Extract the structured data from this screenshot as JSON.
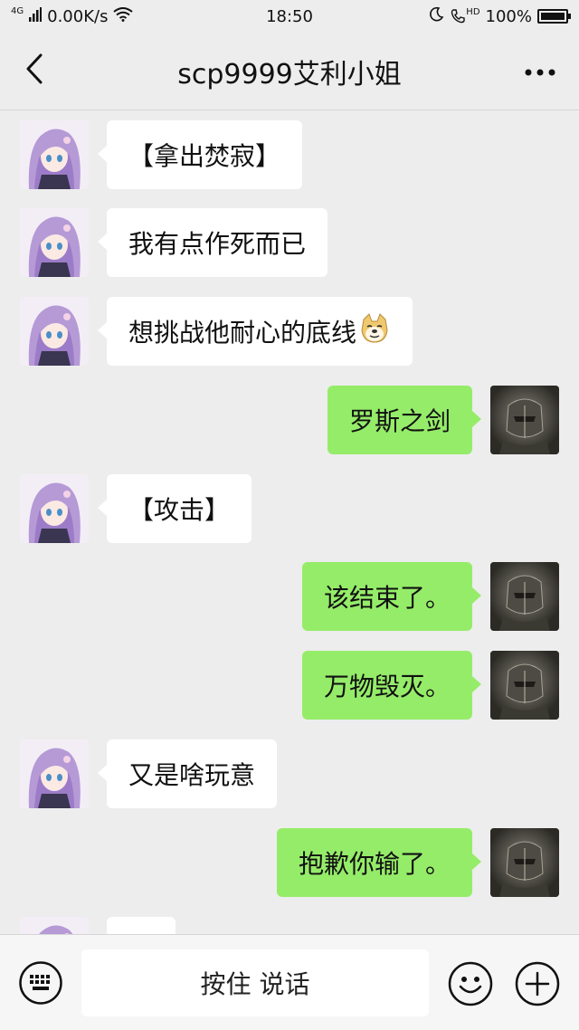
{
  "status_bar": {
    "network_type": "4G",
    "speed": "0.00K/s",
    "time": "18:50",
    "call_label": "HD",
    "battery": "100%",
    "battery_level": 1.0
  },
  "header": {
    "title": "scp9999艾利小姐"
  },
  "messages": [
    {
      "side": "left",
      "text": "【拿出焚寂】",
      "avatar": "anime-girl-avatar"
    },
    {
      "side": "left",
      "text": "我有点作死而已",
      "avatar": "anime-girl-avatar"
    },
    {
      "side": "left",
      "text": "想挑战他耐心的底线",
      "emoji": "doge-emoji",
      "avatar": "anime-girl-avatar"
    },
    {
      "side": "right",
      "text": "罗斯之剑",
      "avatar": "dark-armor-avatar"
    },
    {
      "side": "left",
      "text": "【攻击】",
      "avatar": "anime-girl-avatar"
    },
    {
      "side": "right",
      "text": "该结束了。",
      "avatar": "dark-armor-avatar"
    },
    {
      "side": "right",
      "text": "万物毁灭。",
      "avatar": "dark-armor-avatar"
    },
    {
      "side": "left",
      "text": "又是啥玩意",
      "avatar": "anime-girl-avatar"
    },
    {
      "side": "right",
      "text": "抱歉你输了。",
      "avatar": "dark-armor-avatar"
    },
    {
      "side": "left",
      "text": "",
      "avatar": "anime-girl-avatar"
    }
  ],
  "input_bar": {
    "voice_label": "按住 说话"
  },
  "colors": {
    "background": "#ededed",
    "incoming_bubble": "#ffffff",
    "outgoing_bubble": "#95ec69"
  }
}
